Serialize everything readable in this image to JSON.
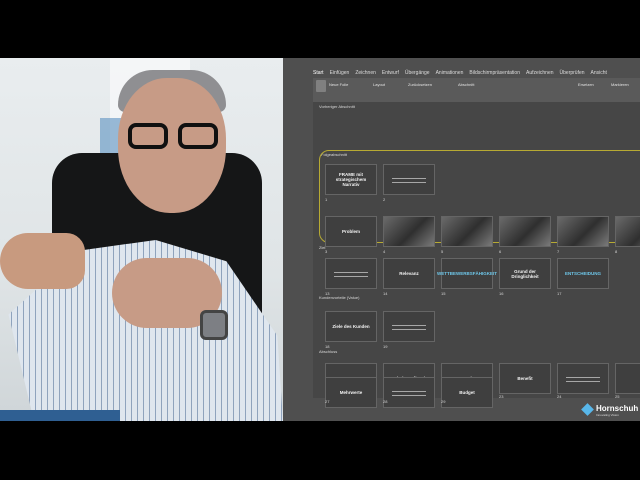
{
  "ribbon": {
    "tabs": [
      "Start",
      "Einfügen",
      "Zeichnen",
      "Entwurf",
      "Übergänge",
      "Animationen",
      "Bildschirmpräsentation",
      "Aufzeichnen",
      "Überprüfen",
      "Ansicht"
    ],
    "group_labels": [
      "Neue Folie",
      "Layout",
      "Zurücksetzen",
      "Abschnitt",
      "Ersetzen",
      "Markieren"
    ]
  },
  "sorter": {
    "sections": [
      {
        "title": "Vorheriger Abschnitt"
      },
      {
        "title": "Folgeabschnitt"
      },
      {
        "title": "Ziel"
      },
      {
        "title": "Kundenvorteile (Value)"
      },
      {
        "title": "Abschluss"
      }
    ],
    "slides": [
      {
        "num": "1",
        "label": "FRAME\nmit strategischem Narrativ",
        "style": "text"
      },
      {
        "num": "2",
        "label": "",
        "style": "lines"
      },
      {
        "num": "3",
        "label": "Problem",
        "style": "text"
      },
      {
        "num": "4",
        "label": "",
        "style": "photo"
      },
      {
        "num": "5",
        "label": "",
        "style": "photo"
      },
      {
        "num": "6",
        "label": "",
        "style": "photo"
      },
      {
        "num": "7",
        "label": "",
        "style": "photo"
      },
      {
        "num": "8",
        "label": "",
        "style": "photo"
      },
      {
        "num": "13",
        "label": "",
        "style": "lines"
      },
      {
        "num": "14",
        "label": "Relevanz",
        "style": "text"
      },
      {
        "num": "15",
        "label": "WETTBEWERBSFÄHIGKEIT",
        "style": "cyan"
      },
      {
        "num": "16",
        "label": "Grund der Dringlichkeit",
        "style": "text"
      },
      {
        "num": "17",
        "label": "ENTSCHEIDUNG",
        "style": "cyan"
      },
      {
        "num": "18",
        "label": "Ziele des Kunden",
        "style": "text"
      },
      {
        "num": "19",
        "label": "",
        "style": "lines"
      },
      {
        "num": "20",
        "label": "Was",
        "style": "text"
      },
      {
        "num": "21",
        "label": "Wie\n(Proof/Tos)",
        "style": "text"
      },
      {
        "num": "22",
        "label": "Damit",
        "style": "text"
      },
      {
        "num": "23",
        "label": "Benefit",
        "style": "text"
      },
      {
        "num": "24",
        "label": "",
        "style": "lines"
      },
      {
        "num": "25",
        "label": "",
        "style": "text"
      },
      {
        "num": "27",
        "label": "Mehrwerte",
        "style": "text"
      },
      {
        "num": "28",
        "label": "",
        "style": "lines"
      },
      {
        "num": "29",
        "label": "Budget",
        "style": "text"
      }
    ]
  },
  "logo": {
    "name": "Hornschuh",
    "subtitle": "Innovating Vision"
  }
}
